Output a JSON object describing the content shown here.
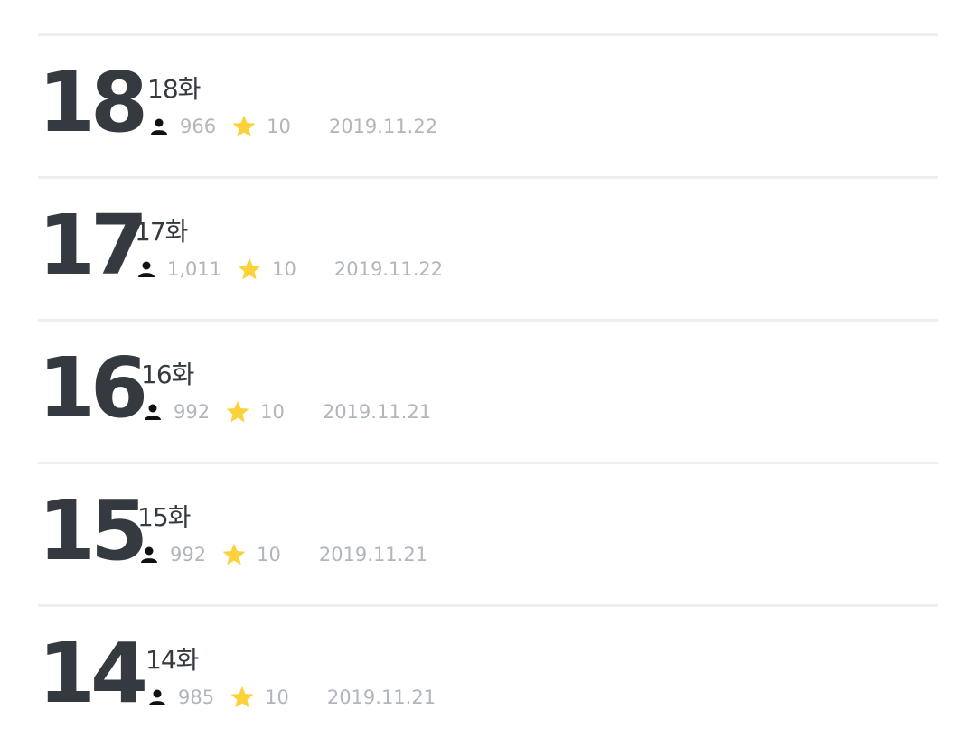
{
  "episodes": [
    {
      "number": "18",
      "title": "18화",
      "views": "966",
      "rating": "10",
      "date": "2019.11.22"
    },
    {
      "number": "17",
      "title": "17화",
      "views": "1,011",
      "rating": "10",
      "date": "2019.11.22"
    },
    {
      "number": "16",
      "title": "16화",
      "views": "992",
      "rating": "10",
      "date": "2019.11.21"
    },
    {
      "number": "15",
      "title": "15화",
      "views": "992",
      "rating": "10",
      "date": "2019.11.21"
    },
    {
      "number": "14",
      "title": "14화",
      "views": "985",
      "rating": "10",
      "date": "2019.11.21"
    }
  ],
  "icons": {
    "views": "user-icon",
    "rating": "star-icon"
  },
  "colors": {
    "star": "#fcd23b",
    "number": "#343a40",
    "meta": "#b0b6bb",
    "divider": "#eeeff0"
  }
}
